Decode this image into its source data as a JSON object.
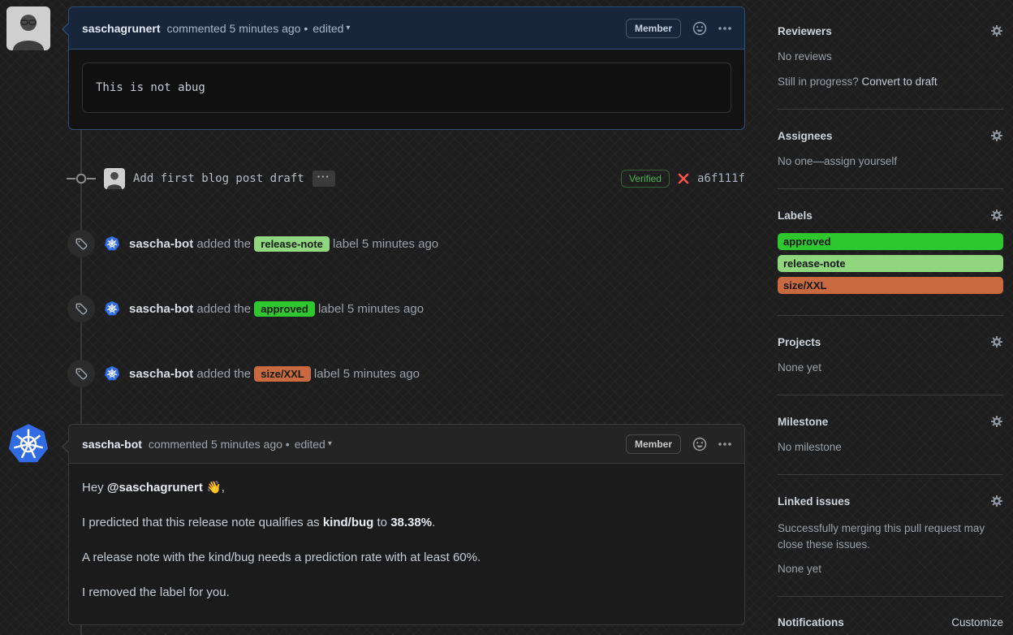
{
  "comment1": {
    "author": "saschagrunert",
    "meta": "commented 5 minutes ago •",
    "edited_label": "edited",
    "member_badge": "Member",
    "body_code": "This is not abug"
  },
  "commit": {
    "message": "Add first blog post draft",
    "expand_icon": "···",
    "verified_badge": "Verified",
    "hash": "a6f111f"
  },
  "label_events": [
    {
      "actor": "sascha-bot",
      "action": "added the",
      "label": "release-note",
      "label_bg": "#8fd67f",
      "suffix": "label 5 minutes ago"
    },
    {
      "actor": "sascha-bot",
      "action": "added the",
      "label": "approved",
      "label_bg": "#2ec72e",
      "suffix": "label 5 minutes ago"
    },
    {
      "actor": "sascha-bot",
      "action": "added the",
      "label": "size/XXL",
      "label_bg": "#c8693f",
      "suffix": "label 5 minutes ago"
    }
  ],
  "comment2": {
    "author": "sascha-bot",
    "meta": "commented 5 minutes ago •",
    "edited_label": "edited",
    "member_badge": "Member",
    "p1_prefix": "Hey ",
    "p1_mention": "@saschagrunert",
    "p1_wave": " 👋",
    "p1_suffix": ",",
    "p2_prefix": "I predicted that this release note qualifies as ",
    "p2_bold1": "kind/bug",
    "p2_mid": " to ",
    "p2_bold2": "38.38%",
    "p2_suffix": ".",
    "p3": "A release note with the kind/bug needs a prediction rate with at least 60%.",
    "p4": "I removed the label for you."
  },
  "sidebar": {
    "reviewers": {
      "title": "Reviewers",
      "empty": "No reviews",
      "hint_prefix": "Still in progress? ",
      "hint_link": "Convert to draft"
    },
    "assignees": {
      "title": "Assignees",
      "empty": "No one—assign yourself"
    },
    "labels": {
      "title": "Labels",
      "items": [
        {
          "name": "approved",
          "bg": "#2ec72e"
        },
        {
          "name": "release-note",
          "bg": "#8fd67f"
        },
        {
          "name": "size/XXL",
          "bg": "#c8693f"
        }
      ]
    },
    "projects": {
      "title": "Projects",
      "empty": "None yet"
    },
    "milestone": {
      "title": "Milestone",
      "empty": "No milestone"
    },
    "linked_issues": {
      "title": "Linked issues",
      "description": "Successfully merging this pull request may close these issues.",
      "empty": "None yet"
    },
    "notifications": {
      "title": "Notifications",
      "customize": "Customize"
    }
  },
  "colors": {
    "k8s_blue": "#326ce5",
    "verified_green": "#4fb153",
    "failed_x_red": "#f85149",
    "highlight_border_blue": "#2f4d74"
  }
}
